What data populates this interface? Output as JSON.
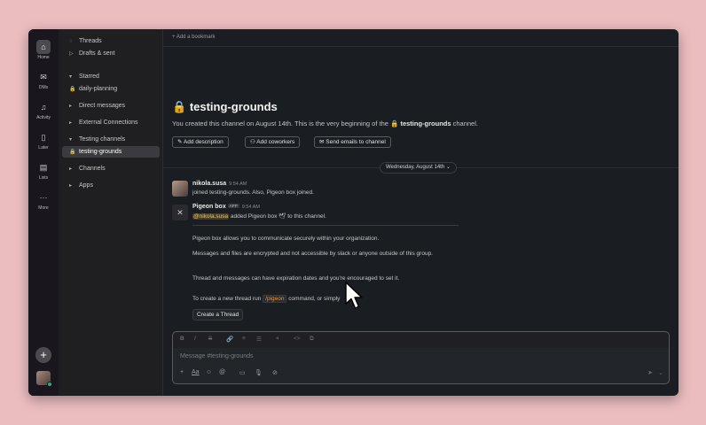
{
  "rail": {
    "items": [
      {
        "label": "Home",
        "icon": "⌂"
      },
      {
        "label": "DMs",
        "icon": "✉"
      },
      {
        "label": "Activity",
        "icon": "♫"
      },
      {
        "label": "Later",
        "icon": "▯"
      },
      {
        "label": "Lists",
        "icon": "▤"
      },
      {
        "label": "More",
        "icon": "···"
      }
    ],
    "plus": "+"
  },
  "sidebar": {
    "threads": "Threads",
    "drafts": "Drafts & sent",
    "starred": "Starred",
    "daily_planning": "daily-planning",
    "direct_messages": "Direct messages",
    "external": "External Connections",
    "testing_channels": "Testing channels",
    "testing_grounds": "testing-grounds",
    "channels": "Channels",
    "apps": "Apps"
  },
  "topbar": {
    "add_bookmark": "+ Add a bookmark"
  },
  "channel": {
    "name": "testing-grounds",
    "desc_pre": "You created this channel on August 14th. This is the very beginning of the ",
    "desc_channel": "testing-grounds",
    "desc_post": " channel.",
    "actions": {
      "add_description": "Add description",
      "add_coworkers": "Add coworkers",
      "send_emails": "Send emails to channel"
    }
  },
  "date_divider": "Wednesday, August 14th",
  "messages": {
    "user": {
      "name": "nikola.susa",
      "time": "9:54 AM",
      "text": "joined testing-grounds. Also, Pigeon box joined."
    },
    "bot": {
      "name": "Pigeon box",
      "badge": "APP",
      "time": "9:54 AM",
      "mention": "@nikola.susa",
      "added": " added Pigeon box 🕊 to this channel.",
      "p1": "Pigeon box allows you to communicate securely within your organization.",
      "p2": "Messages and files are encrypted and not accessible by slack or anyone outside of this group.",
      "p3": "Thread and messages can have expiration dates and you're encouraged to set it.",
      "p4_pre": "To create a new thread run ",
      "p4_code": "/pigeon",
      "p4_post": " command, or simply",
      "create_thread": "Create a Thread"
    }
  },
  "composer": {
    "placeholder": "Message #testing-grounds",
    "format": [
      "B",
      "I",
      "S",
      "🔗",
      "≡",
      "☰",
      "❝",
      "<>",
      "⧉"
    ],
    "tools": [
      "+",
      "Aa",
      "☺",
      "@",
      "▭",
      "🎙",
      "⊘"
    ],
    "send": "➤",
    "send_opt": "⌄"
  },
  "colors": {
    "accent": "#e8913b",
    "mention": "#e8c56a",
    "online": "#2bac76"
  }
}
